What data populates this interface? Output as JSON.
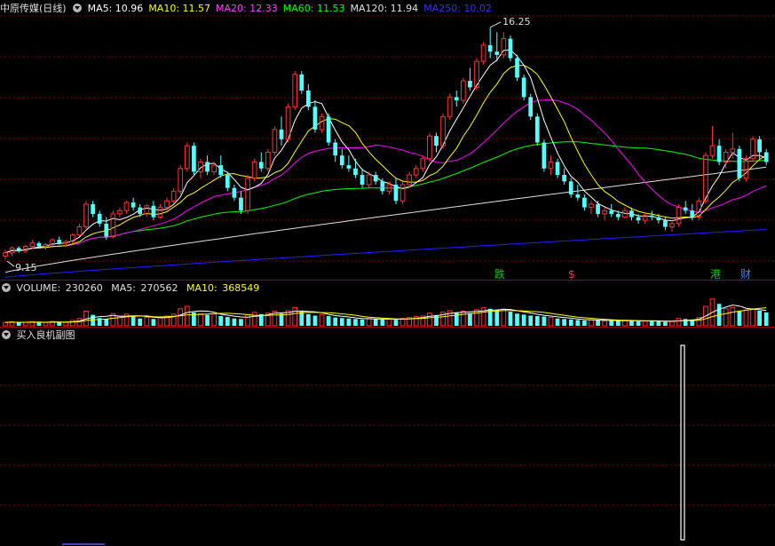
{
  "colors": {
    "background": "#000000",
    "up": "#ff3232",
    "down": "#54ffff",
    "ma5": "#ffffff",
    "ma10": "#ffff00",
    "ma20": "#ff00ff",
    "ma60": "#00ff00",
    "ma120": "#e0e0e0",
    "ma250": "#2020ff",
    "grid": "#8b0000",
    "separator": "#a00000"
  },
  "main_panel": {
    "title": "中原传媒(日线)",
    "toggle_icon": "collapse-triangle-icon",
    "indicators": [
      {
        "label": "MA5:",
        "value": "10.96",
        "color": "#ffffff"
      },
      {
        "label": "MA10:",
        "value": "11.57",
        "color": "#ffff00"
      },
      {
        "label": "MA20:",
        "value": "12.33",
        "color": "#ff40ff"
      },
      {
        "label": "MA60:",
        "value": "11.53",
        "color": "#00ff00"
      },
      {
        "label": "MA120:",
        "value": "11.94",
        "color": "#e0e0e0"
      },
      {
        "label": "MA250:",
        "value": "10.02",
        "color": "#3030ff"
      }
    ],
    "high_marker": "16.25",
    "low_marker": "9.15",
    "event_tags": [
      {
        "text": "跌",
        "color": "#00cc00"
      },
      {
        "text": "$",
        "color": "#ff3030"
      },
      {
        "text": "港",
        "color": "#00cc00"
      },
      {
        "text": "财",
        "color": "#4080ff"
      }
    ]
  },
  "volume_panel": {
    "label": "VOLUME:",
    "value": "230260",
    "ma5_label": "MA5:",
    "ma5_value": "270562",
    "ma10_label": "MA10:",
    "ma10_value": "368549"
  },
  "sub_panel": {
    "title": "买入良机副图",
    "signal_bar_count": 1
  },
  "chart_data": {
    "type": "candlestick",
    "y_range": [
      8.5,
      16.6
    ],
    "candles": [
      [
        9.2,
        9.4,
        9.1,
        9.3
      ],
      [
        9.3,
        9.5,
        9.2,
        9.45
      ],
      [
        9.45,
        9.5,
        9.3,
        9.35
      ],
      [
        9.35,
        9.55,
        9.3,
        9.5
      ],
      [
        9.5,
        9.7,
        9.4,
        9.6
      ],
      [
        9.6,
        9.65,
        9.45,
        9.5
      ],
      [
        9.5,
        9.6,
        9.4,
        9.55
      ],
      [
        9.55,
        9.75,
        9.5,
        9.7
      ],
      [
        9.7,
        9.8,
        9.55,
        9.6
      ],
      [
        9.6,
        9.7,
        9.5,
        9.65
      ],
      [
        9.65,
        9.9,
        9.6,
        9.85
      ],
      [
        9.85,
        10.2,
        9.8,
        10.1
      ],
      [
        10.1,
        10.9,
        10.0,
        10.8
      ],
      [
        10.8,
        10.9,
        10.4,
        10.5
      ],
      [
        10.5,
        10.6,
        10.1,
        10.2
      ],
      [
        10.2,
        10.4,
        9.7,
        9.8
      ],
      [
        9.8,
        10.6,
        9.75,
        10.5
      ],
      [
        10.5,
        10.7,
        10.4,
        10.6
      ],
      [
        10.6,
        10.9,
        10.5,
        10.85
      ],
      [
        10.85,
        11.0,
        10.6,
        10.7
      ],
      [
        10.7,
        10.8,
        10.4,
        10.5
      ],
      [
        10.5,
        10.8,
        10.4,
        10.75
      ],
      [
        10.75,
        10.9,
        10.3,
        10.4
      ],
      [
        10.4,
        10.8,
        10.35,
        10.7
      ],
      [
        10.7,
        11.0,
        10.6,
        10.9
      ],
      [
        10.9,
        11.3,
        10.8,
        11.2
      ],
      [
        11.2,
        12.0,
        11.1,
        11.9
      ],
      [
        11.9,
        12.7,
        11.8,
        12.6
      ],
      [
        12.6,
        12.7,
        11.7,
        11.8
      ],
      [
        11.8,
        12.2,
        11.6,
        12.1
      ],
      [
        12.1,
        12.3,
        11.7,
        11.8
      ],
      [
        11.8,
        12.1,
        11.7,
        12.0
      ],
      [
        12.0,
        12.3,
        11.6,
        11.7
      ],
      [
        11.7,
        11.8,
        11.2,
        11.3
      ],
      [
        11.3,
        11.4,
        10.9,
        11.0
      ],
      [
        11.0,
        11.2,
        10.5,
        10.6
      ],
      [
        10.6,
        11.7,
        10.5,
        11.6
      ],
      [
        11.6,
        12.2,
        11.5,
        12.1
      ],
      [
        12.1,
        12.4,
        11.8,
        11.9
      ],
      [
        11.9,
        12.5,
        11.8,
        12.4
      ],
      [
        12.4,
        13.2,
        12.3,
        13.1
      ],
      [
        13.1,
        13.5,
        12.6,
        12.8
      ],
      [
        12.8,
        13.9,
        12.7,
        13.8
      ],
      [
        13.8,
        14.9,
        13.7,
        14.8
      ],
      [
        14.8,
        14.9,
        14.2,
        14.3
      ],
      [
        14.3,
        14.5,
        13.7,
        13.8
      ],
      [
        13.8,
        14.0,
        13.0,
        13.1
      ],
      [
        13.1,
        13.6,
        13.0,
        13.5
      ],
      [
        13.5,
        13.6,
        12.6,
        12.7
      ],
      [
        12.7,
        12.8,
        12.1,
        12.3
      ],
      [
        12.3,
        12.5,
        11.9,
        12.0
      ],
      [
        12.0,
        12.3,
        11.8,
        11.9
      ],
      [
        11.9,
        12.2,
        11.6,
        11.7
      ],
      [
        11.7,
        11.9,
        11.3,
        11.4
      ],
      [
        11.4,
        11.8,
        11.3,
        11.7
      ],
      [
        11.7,
        11.8,
        11.4,
        11.5
      ],
      [
        11.5,
        11.6,
        11.1,
        11.2
      ],
      [
        11.2,
        11.5,
        11.1,
        11.4
      ],
      [
        11.4,
        11.6,
        10.8,
        10.9
      ],
      [
        10.9,
        11.5,
        10.8,
        11.4
      ],
      [
        11.4,
        11.8,
        11.3,
        11.7
      ],
      [
        11.7,
        12.0,
        11.6,
        11.9
      ],
      [
        11.9,
        12.3,
        11.8,
        12.2
      ],
      [
        12.2,
        13.0,
        12.1,
        12.9
      ],
      [
        12.9,
        13.0,
        12.4,
        12.6
      ],
      [
        12.6,
        13.6,
        12.5,
        13.5
      ],
      [
        13.5,
        14.2,
        13.4,
        14.1
      ],
      [
        14.1,
        14.3,
        13.8,
        14.0
      ],
      [
        14.0,
        14.7,
        13.9,
        14.6
      ],
      [
        14.6,
        15.0,
        14.3,
        14.4
      ],
      [
        14.4,
        15.3,
        14.3,
        15.2
      ],
      [
        15.2,
        15.8,
        15.1,
        15.7
      ],
      [
        15.7,
        16.25,
        15.3,
        15.5
      ],
      [
        15.5,
        16.1,
        15.2,
        15.4
      ],
      [
        15.4,
        16.1,
        15.3,
        15.9
      ],
      [
        15.9,
        16.0,
        15.2,
        15.3
      ],
      [
        15.3,
        15.4,
        14.6,
        14.7
      ],
      [
        14.7,
        14.8,
        14.0,
        14.1
      ],
      [
        14.1,
        14.2,
        13.4,
        13.5
      ],
      [
        13.5,
        13.6,
        12.6,
        12.7
      ],
      [
        12.7,
        12.8,
        11.8,
        11.9
      ],
      [
        11.9,
        12.3,
        11.7,
        12.1
      ],
      [
        12.1,
        12.2,
        11.6,
        11.7
      ],
      [
        11.7,
        11.9,
        11.4,
        11.5
      ],
      [
        11.5,
        11.6,
        11.0,
        11.1
      ],
      [
        11.1,
        11.4,
        10.9,
        11.0
      ],
      [
        11.0,
        11.1,
        10.6,
        10.7
      ],
      [
        10.7,
        10.9,
        10.5,
        10.8
      ],
      [
        10.8,
        10.9,
        10.4,
        10.5
      ],
      [
        10.5,
        10.7,
        10.3,
        10.6
      ],
      [
        10.6,
        10.8,
        10.4,
        10.5
      ],
      [
        10.5,
        10.6,
        10.3,
        10.4
      ],
      [
        10.4,
        10.7,
        10.35,
        10.6
      ],
      [
        10.6,
        10.7,
        10.3,
        10.4
      ],
      [
        10.4,
        10.5,
        10.2,
        10.3
      ],
      [
        10.3,
        10.5,
        10.2,
        10.45
      ],
      [
        10.45,
        10.6,
        10.3,
        10.4
      ],
      [
        10.4,
        10.5,
        10.2,
        10.3
      ],
      [
        10.3,
        10.4,
        10.0,
        10.1
      ],
      [
        10.1,
        10.3,
        9.95,
        10.2
      ],
      [
        10.2,
        10.8,
        10.1,
        10.7
      ],
      [
        10.7,
        10.9,
        10.5,
        10.6
      ],
      [
        10.6,
        10.8,
        10.3,
        10.4
      ],
      [
        10.4,
        11.0,
        10.3,
        10.9
      ],
      [
        10.9,
        12.4,
        10.8,
        12.3
      ],
      [
        12.3,
        13.2,
        12.2,
        12.6
      ],
      [
        12.6,
        12.8,
        12.0,
        12.1
      ],
      [
        12.1,
        12.5,
        11.9,
        12.4
      ],
      [
        12.4,
        13.0,
        12.2,
        12.5
      ],
      [
        12.5,
        12.6,
        11.5,
        11.6
      ],
      [
        11.6,
        12.3,
        11.5,
        12.2
      ],
      [
        12.2,
        12.9,
        12.1,
        12.8
      ],
      [
        12.8,
        12.9,
        12.2,
        12.4
      ],
      [
        12.4,
        12.5,
        12.0,
        12.1
      ]
    ],
    "volumes": [
      14,
      16,
      13,
      15,
      17,
      14,
      13,
      18,
      15,
      14,
      22,
      30,
      60,
      45,
      32,
      28,
      50,
      40,
      48,
      38,
      30,
      35,
      28,
      34,
      40,
      48,
      70,
      80,
      55,
      50,
      45,
      48,
      40,
      36,
      30,
      28,
      45,
      55,
      48,
      52,
      60,
      50,
      62,
      75,
      58,
      48,
      42,
      46,
      40,
      34,
      32,
      30,
      28,
      26,
      30,
      28,
      26,
      28,
      25,
      30,
      34,
      38,
      40,
      52,
      44,
      56,
      62,
      55,
      60,
      52,
      66,
      74,
      70,
      64,
      68,
      58,
      50,
      46,
      42,
      40,
      38,
      34,
      30,
      28,
      26,
      24,
      22,
      24,
      22,
      20,
      22,
      20,
      22,
      20,
      18,
      20,
      20,
      18,
      16,
      18,
      30,
      28,
      26,
      34,
      80,
      110,
      90,
      70,
      75,
      60,
      65,
      70,
      62,
      55
    ],
    "volume_max": 120,
    "ma_periods": [
      5,
      10,
      20,
      60,
      120,
      250
    ],
    "ma120_start_end": [
      8.7,
      11.94
    ],
    "ma250_start_end": [
      8.55,
      10.02
    ]
  }
}
